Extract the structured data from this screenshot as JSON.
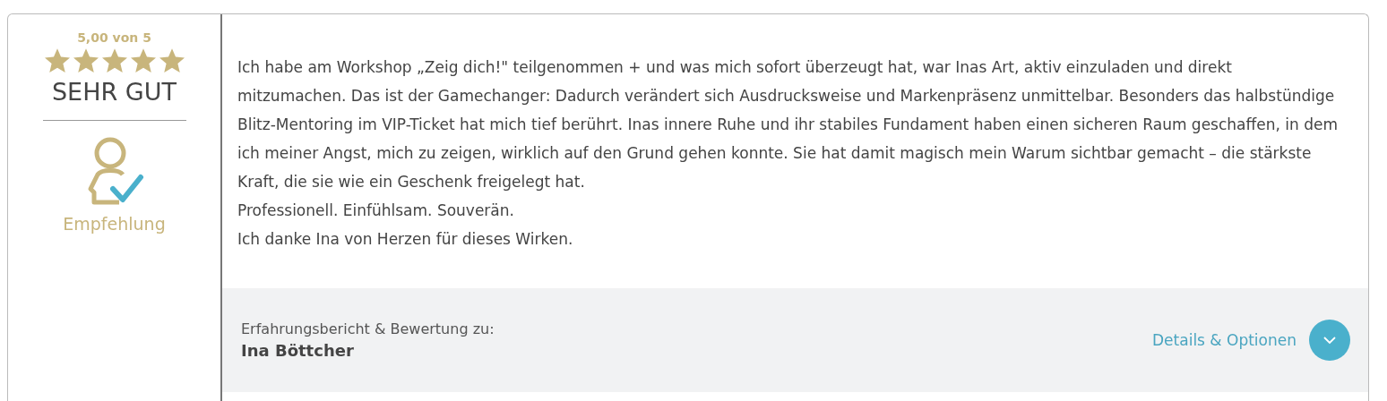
{
  "rating": {
    "score": "5,00 von 5",
    "stars": 5,
    "verdict": "SEHR GUT"
  },
  "recommendation": {
    "label": "Empfehlung"
  },
  "review": {
    "paragraphs": [
      "Ich habe am Workshop „Zeig dich!\" teilgenommen + und was mich sofort überzeugt hat, war Inas Art, aktiv einzuladen und direkt mitzumachen. Das ist der Gamechanger: Dadurch verändert sich Ausdrucksweise und Markenpräsenz unmittelbar. Besonders das halbstündige Blitz-Mentoring im VIP-Ticket hat mich tief berührt. Inas innere Ruhe und ihr stabiles Fundament haben einen sicheren Raum geschaffen, in dem ich meiner Angst, mich zu zeigen, wirklich auf den Grund gehen konnte. Sie hat damit magisch mein Warum sichtbar gemacht – die stärkste Kraft, die sie wie ein Geschenk freigelegt hat.",
      "Professionell. Einfühlsam. Souverän.",
      "Ich danke Ina von Herzen für dieses Wirken."
    ]
  },
  "footer": {
    "caption": "Erfahrungsbericht & Bewertung zu:",
    "subject": "Ina Böttcher",
    "details_link": "Details & Optionen",
    "expanded": false
  }
}
